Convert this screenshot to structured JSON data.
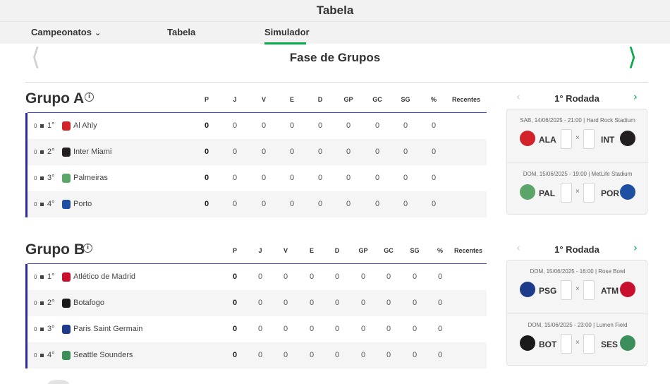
{
  "header": {
    "title": "Tabela"
  },
  "tabs": [
    {
      "label": "Campeonatos",
      "has_dropdown": true,
      "active": false
    },
    {
      "label": "Tabela",
      "active": false
    },
    {
      "label": "Simulador",
      "active": true
    }
  ],
  "phase": {
    "title": "Fase de Grupos",
    "prev_icon": "chevron-left-icon",
    "next_icon": "chevron-right-icon"
  },
  "columns": [
    "P",
    "J",
    "V",
    "E",
    "D",
    "GP",
    "GC",
    "SG",
    "%",
    "Recentes"
  ],
  "colors": {
    "accent": "#06aa48",
    "group_border": "#2b2ba6"
  },
  "groups": [
    {
      "title": "Grupo A",
      "rows": [
        {
          "movement": "0",
          "position": "1°",
          "team": "Al Ahly",
          "crest_color": "#d2232a",
          "values": [
            "0",
            "0",
            "0",
            "0",
            "0",
            "0",
            "0",
            "0",
            "0"
          ]
        },
        {
          "movement": "0",
          "position": "2°",
          "team": "Inter Miami",
          "crest_color": "#231f20",
          "values": [
            "0",
            "0",
            "0",
            "0",
            "0",
            "0",
            "0",
            "0",
            "0"
          ]
        },
        {
          "movement": "0",
          "position": "3°",
          "team": "Palmeiras",
          "crest_color": "#5aa66a",
          "values": [
            "0",
            "0",
            "0",
            "0",
            "0",
            "0",
            "0",
            "0",
            "0"
          ]
        },
        {
          "movement": "0",
          "position": "4°",
          "team": "Porto",
          "crest_color": "#1e4fa3",
          "values": [
            "0",
            "0",
            "0",
            "0",
            "0",
            "0",
            "0",
            "0",
            "0"
          ]
        }
      ],
      "round": {
        "title": "1° Rodada",
        "matches": [
          {
            "info": "SAB, 14/06/2025 - 21:00 | Hard Rock Stadium",
            "home": "ALA",
            "away": "INT",
            "home_color": "#d2232a",
            "away_color": "#231f20",
            "separator": "×"
          },
          {
            "info": "DOM, 15/06/2025 - 19:00 | MetLife Stadium",
            "home": "PAL",
            "away": "POR",
            "home_color": "#5aa66a",
            "away_color": "#1e4fa3",
            "separator": "×"
          }
        ]
      }
    },
    {
      "title": "Grupo B",
      "rows": [
        {
          "movement": "0",
          "position": "1°",
          "team": "Atlético de Madrid",
          "crest_color": "#c8102e",
          "values": [
            "0",
            "0",
            "0",
            "0",
            "0",
            "0",
            "0",
            "0",
            "0"
          ]
        },
        {
          "movement": "0",
          "position": "2°",
          "team": "Botafogo",
          "crest_color": "#1a1a1a",
          "values": [
            "0",
            "0",
            "0",
            "0",
            "0",
            "0",
            "0",
            "0",
            "0"
          ]
        },
        {
          "movement": "0",
          "position": "3°",
          "team": "Paris Saint Germain",
          "crest_color": "#1d3b8a",
          "values": [
            "0",
            "0",
            "0",
            "0",
            "0",
            "0",
            "0",
            "0",
            "0"
          ]
        },
        {
          "movement": "0",
          "position": "4°",
          "team": "Seattle Sounders",
          "crest_color": "#3a8f5a",
          "values": [
            "0",
            "0",
            "0",
            "0",
            "0",
            "0",
            "0",
            "0",
            "0"
          ]
        }
      ],
      "round": {
        "title": "1° Rodada",
        "matches": [
          {
            "info": "DOM, 15/06/2025 - 16:00 | Rose Bowl",
            "home": "PSG",
            "away": "ATM",
            "home_color": "#1d3b8a",
            "away_color": "#c8102e",
            "separator": "×"
          },
          {
            "info": "DOM, 15/06/2025 - 23:00 | Lumen Field",
            "home": "BOT",
            "away": "SES",
            "home_color": "#1a1a1a",
            "away_color": "#3a8f5a",
            "separator": "×"
          }
        ]
      }
    }
  ]
}
